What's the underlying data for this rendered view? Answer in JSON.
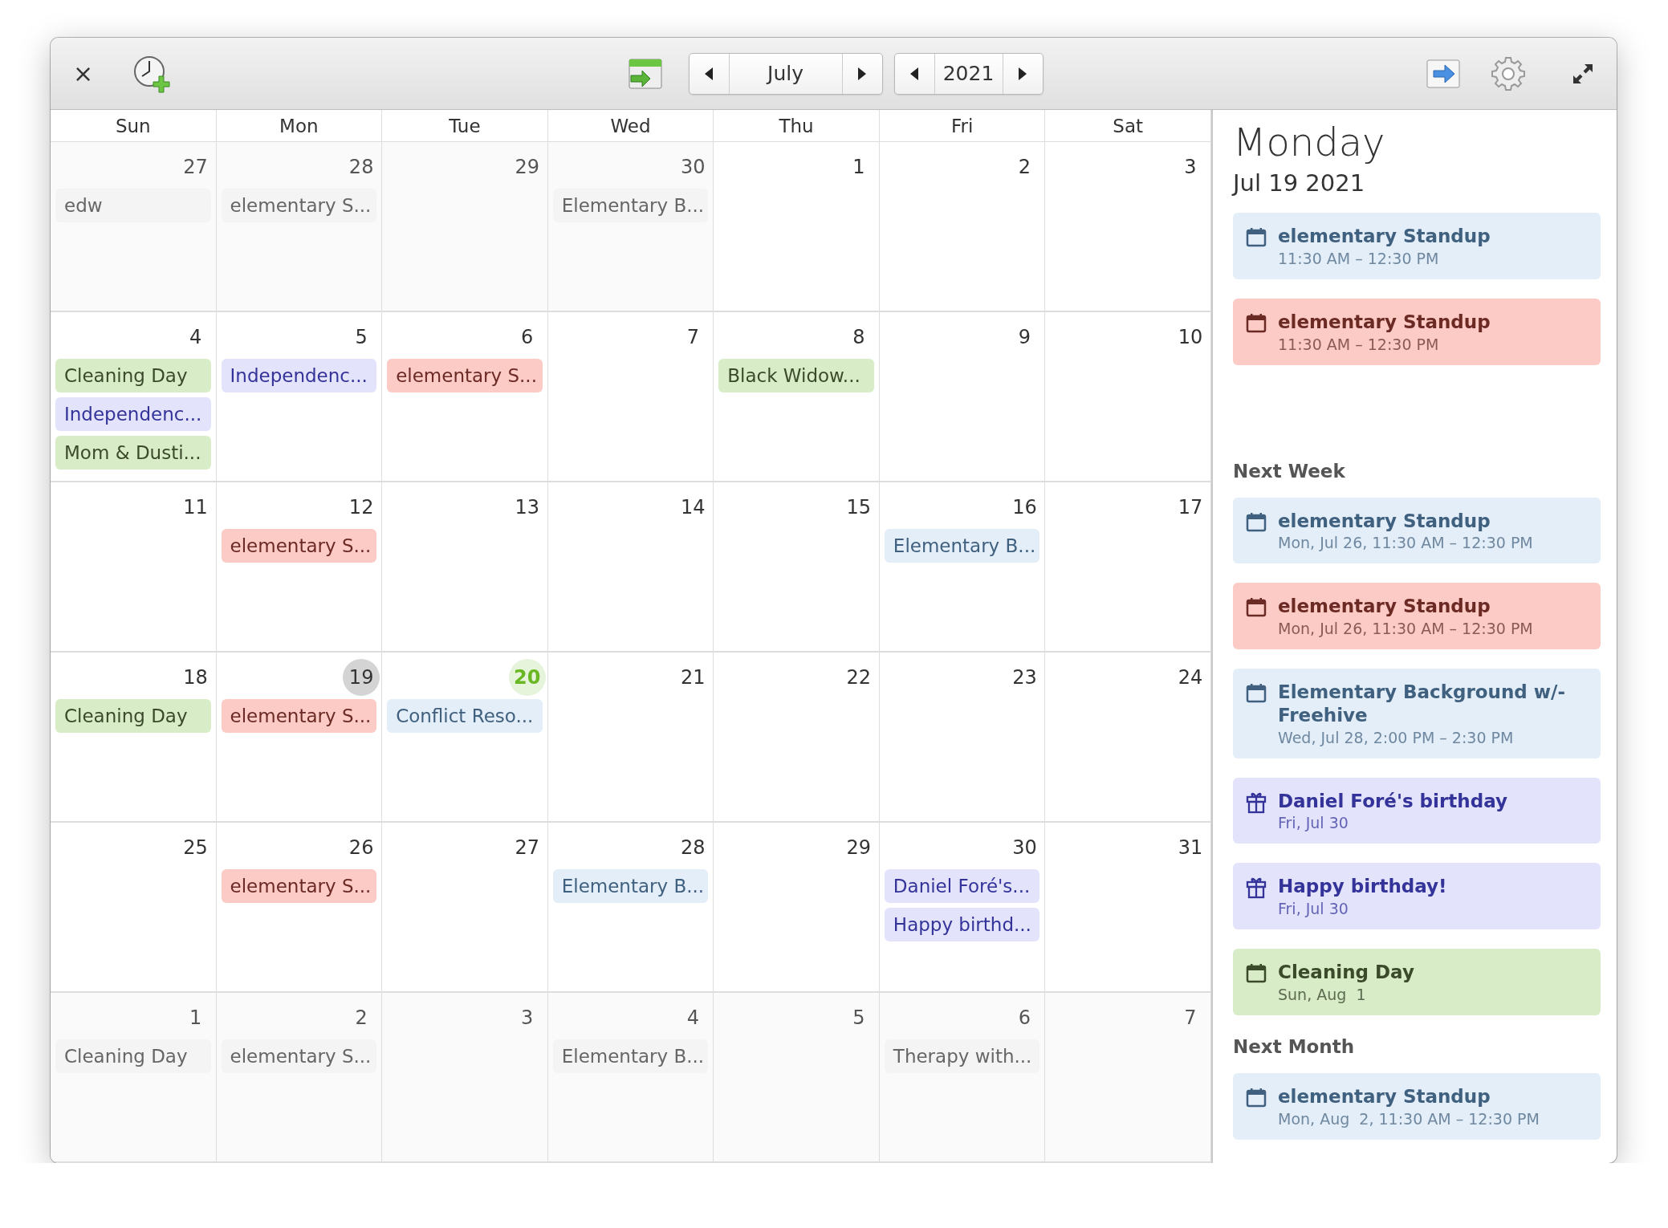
{
  "toolbar": {
    "month": "July",
    "year": "2021",
    "close": "×"
  },
  "weekdays": [
    "Sun",
    "Mon",
    "Tue",
    "Wed",
    "Thu",
    "Fri",
    "Sat"
  ],
  "weeks": [
    {
      "days": [
        {
          "number": "27",
          "other_month": true,
          "selected": false,
          "today": false,
          "events": [
            {
              "title": "edw"
            }
          ]
        },
        {
          "number": "28",
          "other_month": true,
          "selected": false,
          "today": false,
          "events": [
            {
              "title": "elementary S..."
            }
          ]
        },
        {
          "number": "29",
          "other_month": true,
          "selected": false,
          "today": false
        },
        {
          "number": "30",
          "other_month": true,
          "selected": false,
          "today": false,
          "events": [
            {
              "title": "Elementary B..."
            }
          ]
        },
        {
          "number": "1",
          "other_month": false,
          "selected": false,
          "today": false
        },
        {
          "number": "2",
          "other_month": false,
          "selected": false,
          "today": false
        },
        {
          "number": "3",
          "other_month": false,
          "selected": false,
          "today": false
        }
      ]
    },
    {
      "days": [
        {
          "number": "4",
          "other_month": false,
          "selected": false,
          "today": false,
          "events": [
            {
              "title": "Cleaning Day",
              "color": "#d8ecc7"
            },
            {
              "title": "Independenc...",
              "color": "#e3e3fb"
            },
            {
              "title": "Mom & Dusti...",
              "color": "#d8ecc7"
            }
          ]
        },
        {
          "number": "5",
          "other_month": false,
          "selected": false,
          "today": false,
          "events": [
            {
              "title": "Independenc...",
              "color": "#e3e3fb"
            }
          ]
        },
        {
          "number": "6",
          "other_month": false,
          "selected": false,
          "today": false,
          "events": [
            {
              "title": "elementary S...",
              "color": "#fccbc5"
            }
          ]
        },
        {
          "number": "7",
          "other_month": false,
          "selected": false,
          "today": false
        },
        {
          "number": "8",
          "other_month": false,
          "selected": false,
          "today": false,
          "events": [
            {
              "title": "Black Widow...",
              "color": "#d8ecc7"
            }
          ]
        },
        {
          "number": "9",
          "other_month": false,
          "selected": false,
          "today": false
        },
        {
          "number": "10",
          "other_month": false,
          "selected": false,
          "today": false
        }
      ]
    },
    {
      "days": [
        {
          "number": "11",
          "other_month": false,
          "selected": false,
          "today": false
        },
        {
          "number": "12",
          "other_month": false,
          "selected": false,
          "today": false,
          "events": [
            {
              "title": "elementary S...",
              "color": "#fccbc5"
            }
          ]
        },
        {
          "number": "13",
          "other_month": false,
          "selected": false,
          "today": false
        },
        {
          "number": "14",
          "other_month": false,
          "selected": false,
          "today": false
        },
        {
          "number": "15",
          "other_month": false,
          "selected": false,
          "today": false
        },
        {
          "number": "16",
          "other_month": false,
          "selected": false,
          "today": false,
          "events": [
            {
              "title": "Elementary B...",
              "color": "#e3eef8"
            }
          ]
        },
        {
          "number": "17",
          "other_month": false,
          "selected": false,
          "today": false
        }
      ]
    },
    {
      "days": [
        {
          "number": "18",
          "other_month": false,
          "selected": false,
          "today": false,
          "events": [
            {
              "title": "Cleaning Day",
              "color": "#d8ecc7"
            }
          ]
        },
        {
          "number": "19",
          "other_month": false,
          "selected": true,
          "today": false,
          "events": [
            {
              "title": "elementary S...",
              "color": "#fccbc5"
            }
          ]
        },
        {
          "number": "20",
          "other_month": false,
          "selected": false,
          "today": true,
          "events": [
            {
              "title": "Conflict Reso...",
              "color": "#e3eef8"
            }
          ]
        },
        {
          "number": "21",
          "other_month": false,
          "selected": false,
          "today": false
        },
        {
          "number": "22",
          "other_month": false,
          "selected": false,
          "today": false
        },
        {
          "number": "23",
          "other_month": false,
          "selected": false,
          "today": false
        },
        {
          "number": "24",
          "other_month": false,
          "selected": false,
          "today": false
        }
      ]
    },
    {
      "days": [
        {
          "number": "25",
          "other_month": false,
          "selected": false,
          "today": false
        },
        {
          "number": "26",
          "other_month": false,
          "selected": false,
          "today": false,
          "events": [
            {
              "title": "elementary S...",
              "color": "#fccbc5"
            }
          ]
        },
        {
          "number": "27",
          "other_month": false,
          "selected": false,
          "today": false
        },
        {
          "number": "28",
          "other_month": false,
          "selected": false,
          "today": false,
          "events": [
            {
              "title": "Elementary B...",
              "color": "#e3eef8"
            }
          ]
        },
        {
          "number": "29",
          "other_month": false,
          "selected": false,
          "today": false
        },
        {
          "number": "30",
          "other_month": false,
          "selected": false,
          "today": false,
          "events": [
            {
              "title": "Daniel Foré's...",
              "color": "#e3e3fb"
            },
            {
              "title": "Happy birthd...",
              "color": "#e3e3fb"
            }
          ]
        },
        {
          "number": "31",
          "other_month": false,
          "selected": false,
          "today": false
        }
      ]
    },
    {
      "days": [
        {
          "number": "1",
          "other_month": true,
          "selected": false,
          "today": false,
          "events": [
            {
              "title": "Cleaning Day"
            }
          ]
        },
        {
          "number": "2",
          "other_month": true,
          "selected": false,
          "today": false,
          "events": [
            {
              "title": "elementary S..."
            }
          ]
        },
        {
          "number": "3",
          "other_month": true,
          "selected": false,
          "today": false
        },
        {
          "number": "4",
          "other_month": true,
          "selected": false,
          "today": false,
          "events": [
            {
              "title": "Elementary B..."
            }
          ]
        },
        {
          "number": "5",
          "other_month": true,
          "selected": false,
          "today": false
        },
        {
          "number": "6",
          "other_month": true,
          "selected": false,
          "today": false,
          "events": [
            {
              "title": "Therapy with..."
            }
          ]
        },
        {
          "number": "7",
          "other_month": true,
          "selected": false,
          "today": false
        }
      ]
    }
  ],
  "agenda": {
    "day": "Monday",
    "date": "Jul 19 2021",
    "sections": [
      {
        "items": [
          {
            "kind": "calendar",
            "title": "elementary Standup",
            "time": "11:30 AM – 12:30 PM",
            "color": "#e3eef8"
          },
          {
            "kind": "calendar",
            "title": "elementary Standup",
            "time": "11:30 AM – 12:30 PM",
            "color": "#fccbc5"
          }
        ]
      },
      {
        "heading": "Next Week",
        "items": [
          {
            "kind": "calendar",
            "title": "elementary Standup",
            "time": "Mon, Jul 26, 11:30 AM – 12:30 PM",
            "color": "#e3eef8"
          },
          {
            "kind": "calendar",
            "title": "elementary Standup",
            "time": "Mon, Jul 26, 11:30 AM – 12:30 PM",
            "color": "#fccbc5"
          },
          {
            "kind": "calendar",
            "title": "Elementary Background w/- Freehive",
            "time": "Wed, Jul 28, 2:00 PM – 2:30 PM",
            "color": "#e3eef8"
          },
          {
            "kind": "gift",
            "title": "Daniel Foré's birthday",
            "time": "Fri, Jul 30",
            "color": "#e3e3fb"
          },
          {
            "kind": "gift",
            "title": "Happy birthday!",
            "time": "Fri, Jul 30",
            "color": "#e3e3fb"
          },
          {
            "kind": "calendar",
            "title": "Cleaning Day",
            "time": "Sun, Aug  1",
            "color": "#d8ecc7"
          }
        ]
      },
      {
        "heading": "Next Month",
        "items": [
          {
            "kind": "calendar",
            "title": "elementary Standup",
            "time": "Mon, Aug  2, 11:30 AM – 12:30 PM",
            "color": "#e3eef8"
          }
        ]
      }
    ]
  }
}
